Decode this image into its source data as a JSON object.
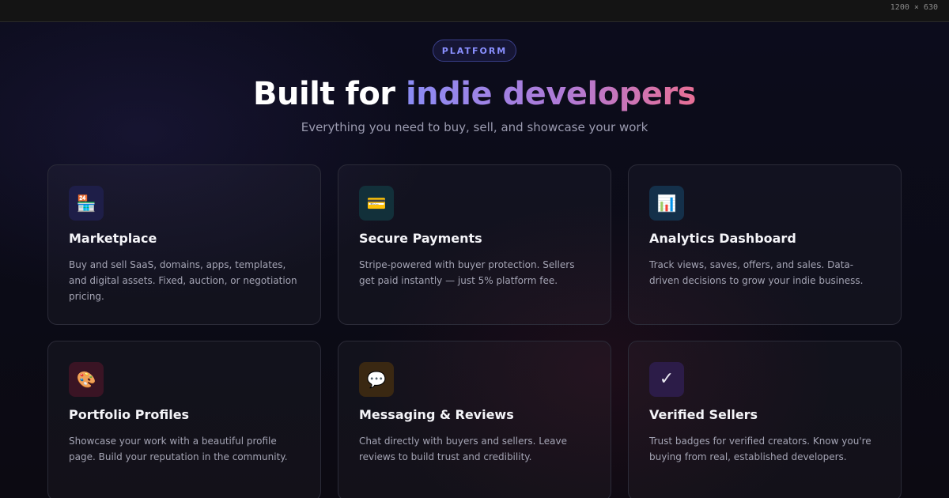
{
  "size_label": "1200 × 630",
  "badge": "PLATFORM",
  "headline": {
    "lead": "Built for ",
    "accent": "indie developers"
  },
  "subtitle": "Everything you need to buy, sell, and showcase your work",
  "features": [
    {
      "title": "Marketplace",
      "description": "Buy and sell SaaS, domains, apps, templates, and digital assets. Fixed, auction, or negotiation pricing.",
      "icon": "store-icon",
      "glyph": "🏪",
      "icon_bg": "#1e1e48"
    },
    {
      "title": "Secure Payments",
      "description": "Stripe-powered with buyer protection. Sellers get paid instantly — just 5% platform fee.",
      "icon": "credit-card-icon",
      "glyph": "💳",
      "icon_bg": "#12303a"
    },
    {
      "title": "Analytics Dashboard",
      "description": "Track views, saves, offers, and sales. Data-driven decisions to grow your indie business.",
      "icon": "bar-chart-icon",
      "glyph": "📊",
      "icon_bg": "#14304a"
    },
    {
      "title": "Portfolio Profiles",
      "description": "Showcase your work with a beautiful profile page. Build your reputation in the community.",
      "icon": "palette-icon",
      "glyph": "🎨",
      "icon_bg": "#3a1424"
    },
    {
      "title": "Messaging & Reviews",
      "description": "Chat directly with buyers and sellers. Leave reviews to build trust and credibility.",
      "icon": "speech-bubble-icon",
      "glyph": "💬",
      "icon_bg": "#3a2812"
    },
    {
      "title": "Verified Sellers",
      "description": "Trust badges for verified creators. Know you're buying from real, established developers.",
      "icon": "checkmark-icon",
      "glyph": "✓",
      "icon_bg": "#2c1c48"
    }
  ]
}
